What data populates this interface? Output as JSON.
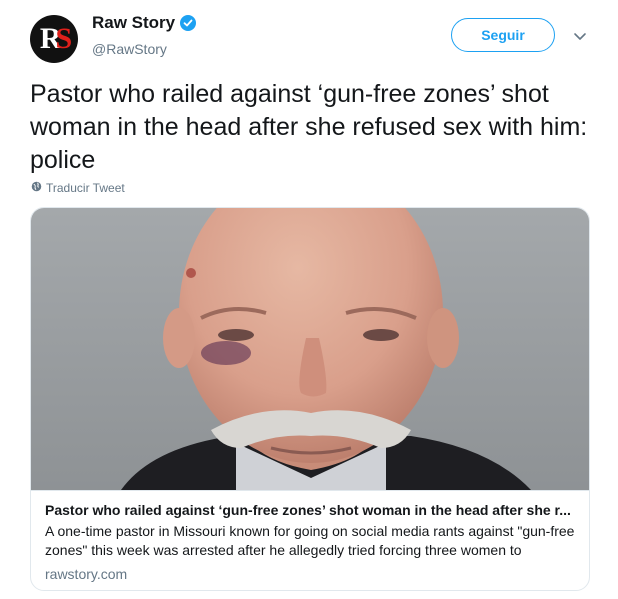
{
  "author": {
    "display_name": "Raw Story",
    "handle": "@RawStory",
    "avatar_logo_r": "R",
    "avatar_logo_s": "S",
    "verified": true
  },
  "header": {
    "follow_label": "Seguir",
    "menu_icon": "chevron-down-icon"
  },
  "tweet": {
    "text": "Pastor who railed against ‘gun-free zones’ shot woman in the head after she refused sex with him: police",
    "translate_label": "Traducir Tweet"
  },
  "card": {
    "title": "Pastor who railed against ‘gun-free zones’ shot woman in the head after she r...",
    "description": "A one-time pastor in Missouri known for going on social media rants against \"gun-free zones\" this week was arrested after he allegedly tried forcing three women to",
    "domain": "rawstory.com"
  },
  "colors": {
    "accent": "#1da1f2",
    "secondary_text": "#657786",
    "border": "#e1e8ed",
    "logo_red": "#e0201b"
  }
}
